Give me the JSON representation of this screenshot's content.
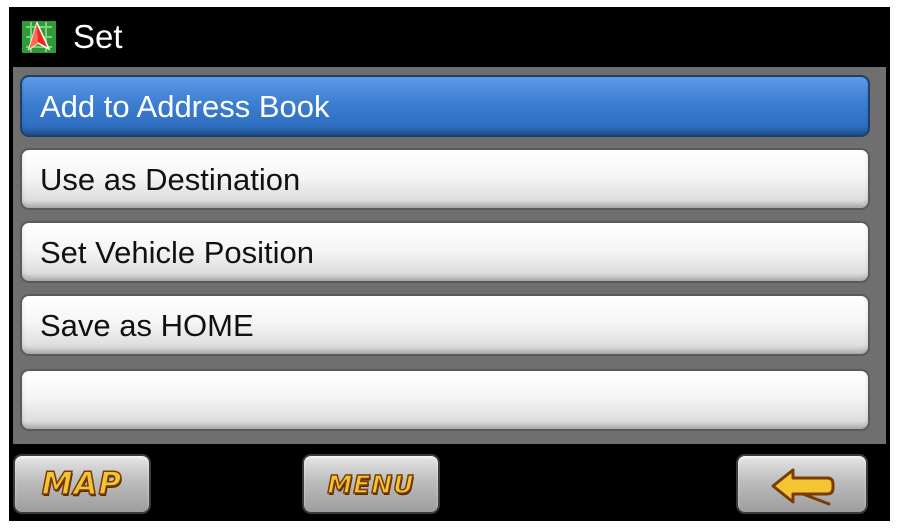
{
  "title": "Set",
  "menu_items": [
    {
      "label": "Add to Address Book",
      "selected": true
    },
    {
      "label": "Use as Destination",
      "selected": false
    },
    {
      "label": "Set Vehicle Position",
      "selected": false
    },
    {
      "label": "Save as HOME",
      "selected": false
    },
    {
      "label": "",
      "selected": false
    }
  ],
  "bottom_buttons": {
    "map": "MAP",
    "menu": "MENU",
    "back_icon": "back-arrow-icon"
  },
  "colors": {
    "title_bar": "#000000",
    "selected_item": "#3c7ed1",
    "item_background": "#f2f2f2",
    "button_text": "#f4c532",
    "button_text_outline": "#7a3c06"
  }
}
